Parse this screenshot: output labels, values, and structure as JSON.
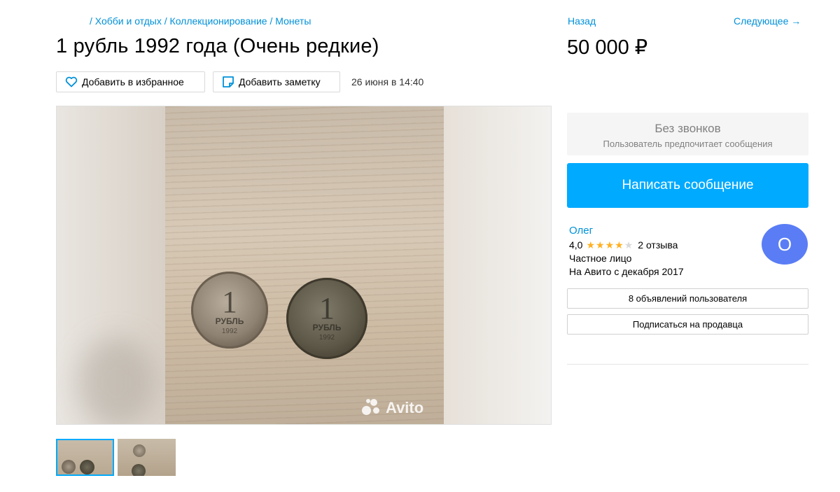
{
  "breadcrumbs": [
    "/ Хобби и отдых",
    "/ Коллекционирование",
    "/ Монеты"
  ],
  "listing": {
    "title": "1 рубль 1992 года (Очень редкие)",
    "price": "50 000 ₽",
    "date": "26 июня в 14:40"
  },
  "nav": {
    "back": "Назад",
    "next": "Следующее →"
  },
  "actions": {
    "favorite": "Добавить в избранное",
    "note": "Добавить заметку"
  },
  "gallery": {
    "watermark": "Avito",
    "coin1": {
      "num": "1",
      "word": "РУБЛЬ",
      "year": "1992"
    },
    "coin2": {
      "num": "1",
      "word": "РУБЛЬ",
      "year": "1992"
    },
    "thumbnails_count": 2,
    "selected_thumbnail": 1
  },
  "contact": {
    "no_calls_title": "Без звонков",
    "no_calls_sub": "Пользователь предпочитает сообщения",
    "message_button": "Написать сообщение"
  },
  "seller": {
    "name": "Олег",
    "rating": "4,0",
    "stars_filled": 4,
    "stars_total": 5,
    "reviews": "2 отзыва",
    "type": "Частное лицо",
    "since": "На Авито с декабря 2017",
    "avatar_letter": "О",
    "ads_button": "8 объявлений пользователя",
    "subscribe_button": "Подписаться на продавца"
  },
  "colors": {
    "accent": "#00aaff",
    "link": "#0091d9",
    "star": "#ffb021",
    "avatar": "#5a7df5"
  }
}
